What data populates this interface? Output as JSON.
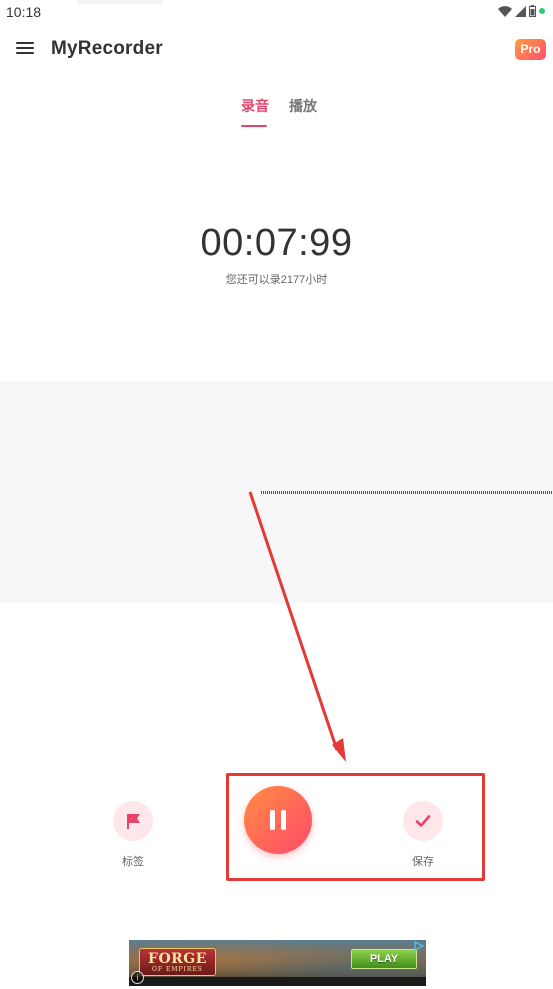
{
  "status_bar": {
    "time": "10:18"
  },
  "app_bar": {
    "title": "MyRecorder",
    "pro_badge": "Pro"
  },
  "tabs": [
    {
      "label": "录音",
      "active": true
    },
    {
      "label": "播放",
      "active": false
    }
  ],
  "recorder": {
    "timer": "00:07:99",
    "remaining_text": "您还可以录2177小时"
  },
  "controls": {
    "flag_label": "标签",
    "save_label": "保存"
  },
  "ad": {
    "logo_text": "FORGE",
    "logo_subtext": "OF EMPIRES",
    "play_label": "PLAY",
    "info_glyph": "i"
  },
  "colors": {
    "accent": "#e8436a",
    "button_gradient_start": "#ff8c42",
    "button_gradient_end": "#ff4a6b",
    "annotation_red": "#e53935"
  }
}
